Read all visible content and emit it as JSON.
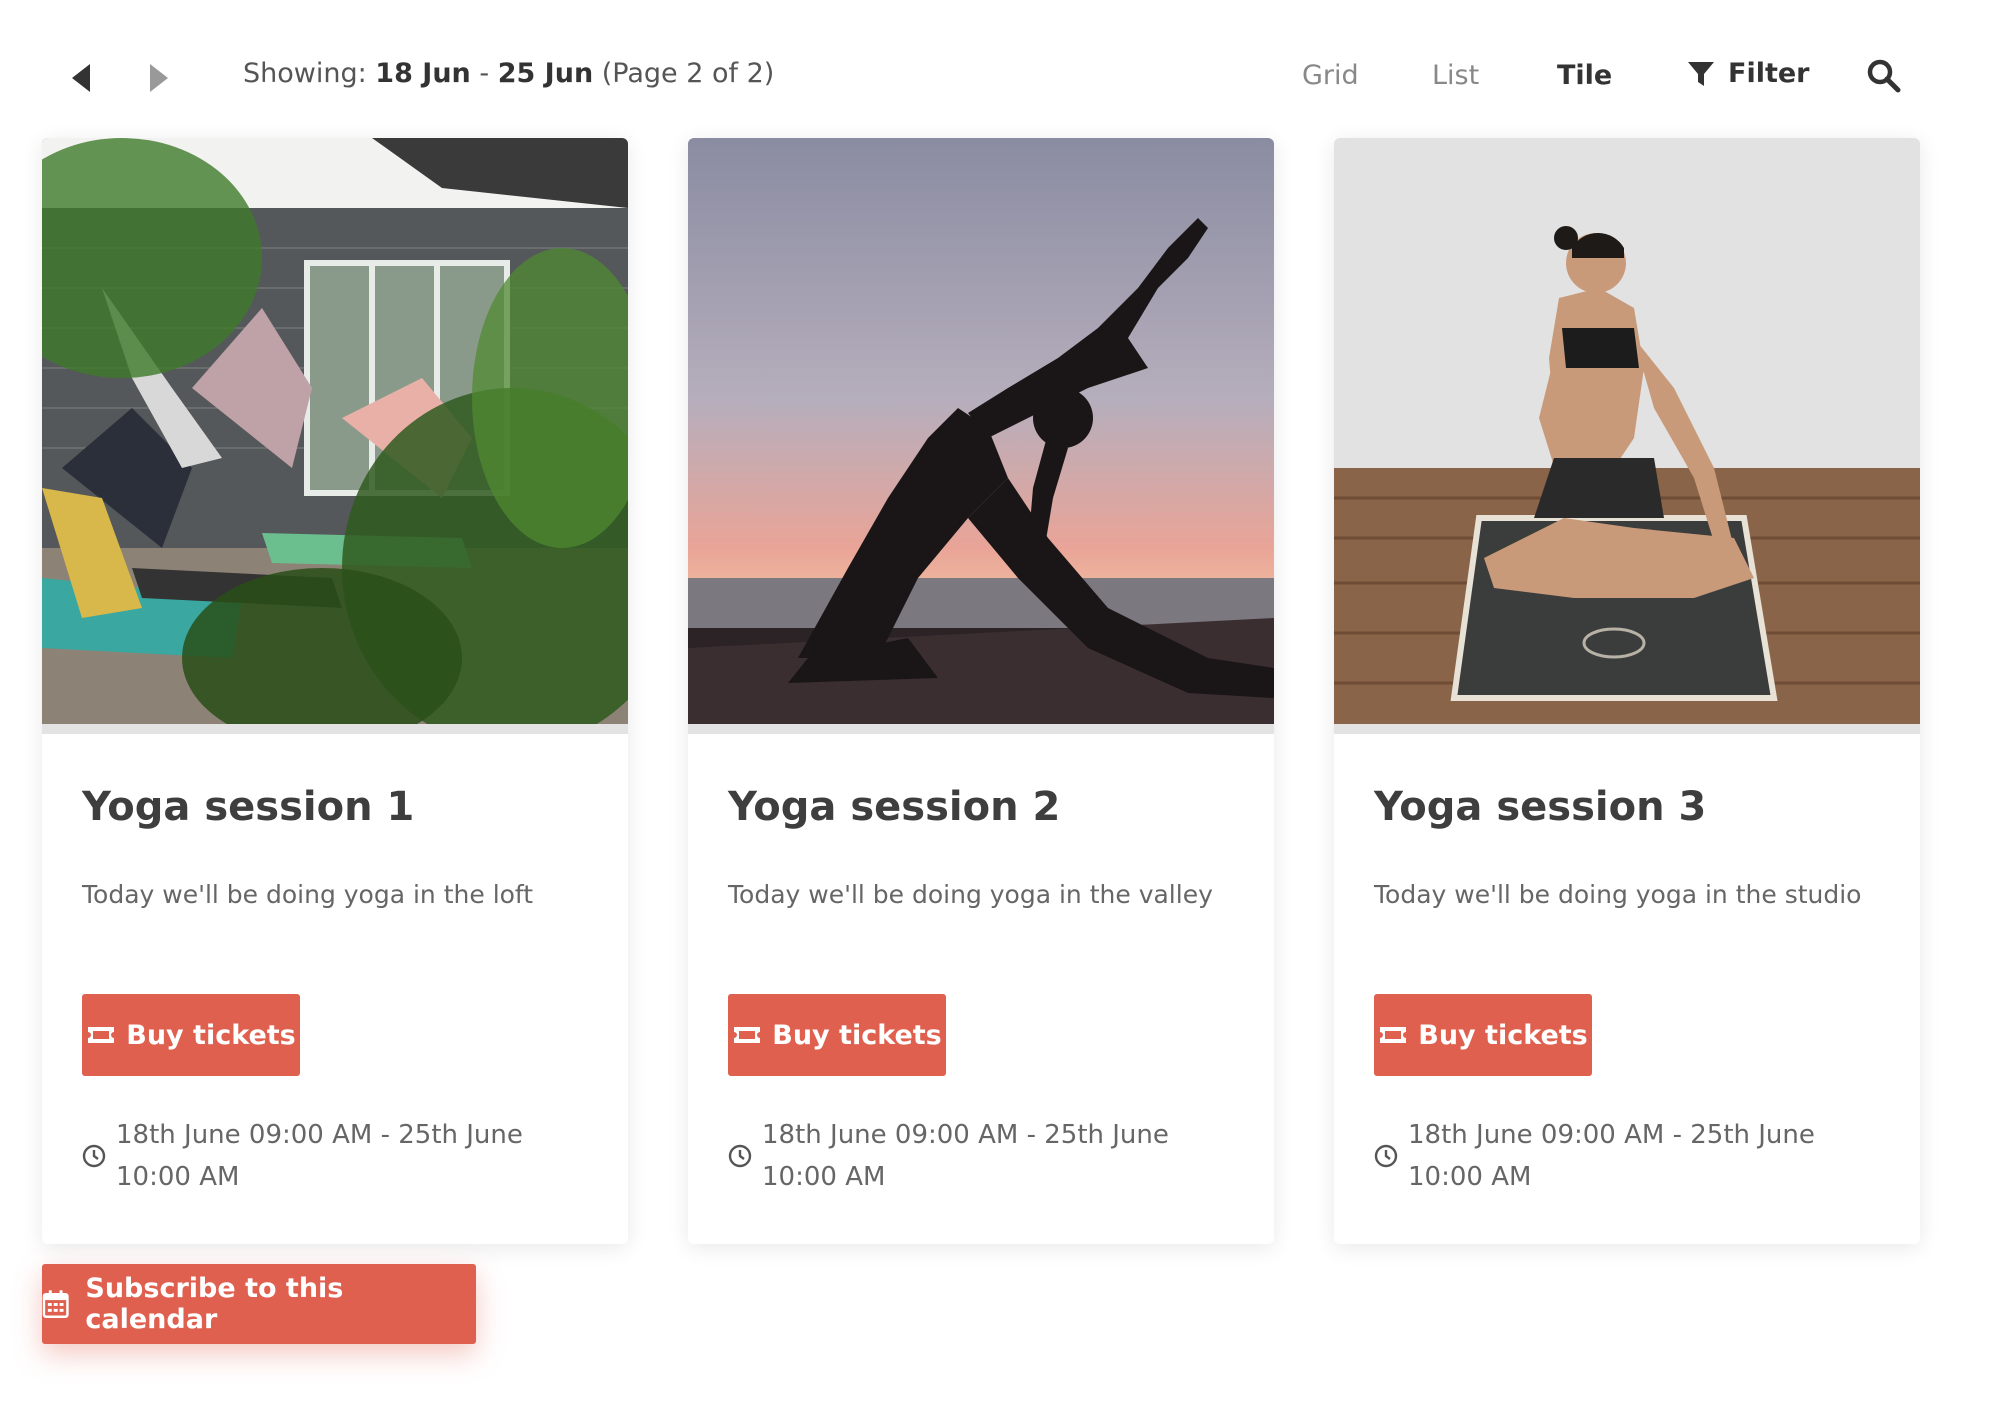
{
  "toolbar": {
    "showing_label": "Showing:",
    "range_start": "18 Jun",
    "range_sep": "-",
    "range_end": "25 Jun",
    "page_info": "(Page 2 of 2)",
    "views": [
      {
        "label": "Grid",
        "active": false
      },
      {
        "label": "List",
        "active": false
      },
      {
        "label": "Tile",
        "active": true
      }
    ],
    "filter_label": "Filter",
    "icons": {
      "prev": "caret-left-icon",
      "next": "caret-right-icon",
      "filter": "funnel-icon",
      "search": "search-icon"
    }
  },
  "events": [
    {
      "title": "Yoga session 1",
      "description": "Today we'll be doing yoga in the loft",
      "button_label": "Buy tickets",
      "time_line1": "18th June 09:00 AM - 25th June",
      "time_line2": "10:00 AM"
    },
    {
      "title": "Yoga session 2",
      "description": "Today we'll be doing yoga in the valley",
      "button_label": "Buy tickets",
      "time_line1": "18th June 09:00 AM - 25th June",
      "time_line2": "10:00 AM"
    },
    {
      "title": "Yoga session 3",
      "description": "Today we'll be doing yoga in the studio",
      "button_label": "Buy tickets",
      "time_line1": "18th June 09:00 AM - 25th June",
      "time_line2": "10:00 AM"
    }
  ],
  "subscribe": {
    "label": "Subscribe to this calendar",
    "icon": "calendar-icon"
  },
  "colors": {
    "accent": "#e06050",
    "title": "#3e3e3e",
    "muted": "#888888"
  }
}
